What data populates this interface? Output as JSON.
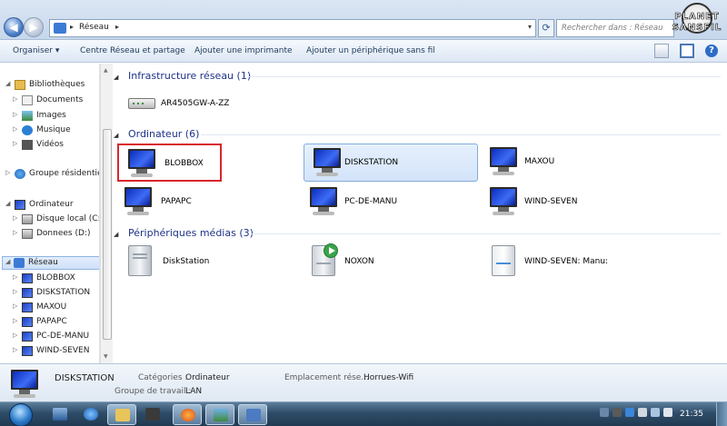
{
  "address": {
    "crumb": "Réseau"
  },
  "search": {
    "placeholder": "Rechercher dans : Réseau"
  },
  "logo": {
    "line1": "PLANET",
    "line2": "SANSFIL"
  },
  "toolbar": {
    "organize": "Organiser ▾",
    "network_center": "Centre Réseau et partage",
    "add_printer": "Ajouter une imprimante",
    "add_wireless": "Ajouter un périphérique sans fil"
  },
  "nav": {
    "libraries": "Bibliothèques",
    "documents": "Documents",
    "images": "Images",
    "music": "Musique",
    "videos": "Vidéos",
    "homegroup": "Groupe résidentiel",
    "computer": "Ordinateur",
    "disk_c": "Disque local (C:)",
    "disk_d": "Donnees (D:)",
    "network": "Réseau",
    "hosts": [
      "BLOBBOX",
      "DISKSTATION",
      "MAXOU",
      "PAPAPC",
      "PC-DE-MANU",
      "WIND-SEVEN"
    ]
  },
  "groups": {
    "infrastructure": "Infrastructure réseau (1)",
    "computers": "Ordinateur (6)",
    "media": "Périphériques médias (3)"
  },
  "infrastructure_items": [
    "AR4505GW-A-ZZ"
  ],
  "computer_items": [
    "BLOBBOX",
    "DISKSTATION",
    "MAXOU",
    "PAPAPC",
    "PC-DE-MANU",
    "WIND-SEVEN"
  ],
  "media_items": [
    "DiskStation",
    "NOXON",
    "WIND-SEVEN: Manu:"
  ],
  "details": {
    "name": "DISKSTATION",
    "categories_label": "Catégories :",
    "categories_value": "Ordinateur",
    "workgroup_label": "Groupe de travail :",
    "workgroup_value": "LAN",
    "location_label": "Emplacement rése...",
    "location_value": "Horrues-Wifi"
  },
  "taskbar": {
    "clock": "21:35"
  },
  "colors": {
    "accent": "#1e3287",
    "selection": "#84acdd",
    "highlight_box": "#d9262c"
  }
}
